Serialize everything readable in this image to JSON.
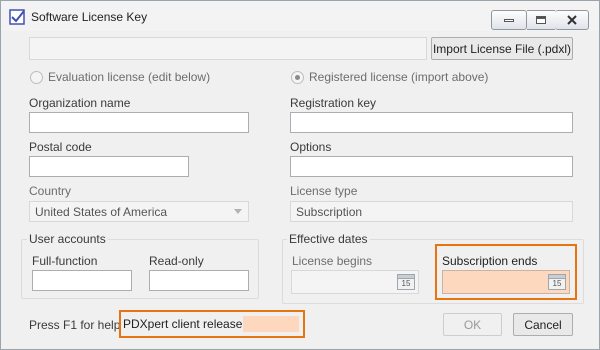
{
  "window": {
    "title": "Software License Key"
  },
  "toolbar": {
    "import_label": "Import License File (.pdxl)"
  },
  "license_mode": {
    "evaluation_label": "Evaluation license (edit below)",
    "registered_label": "Registered license (import above)",
    "selected": "registered"
  },
  "form": {
    "organization_label": "Organization name",
    "organization_value": "",
    "postal_label": "Postal code",
    "postal_value": "",
    "country_label": "Country",
    "country_value": "United States of America",
    "registration_key_label": "Registration key",
    "registration_key_value": "",
    "options_label": "Options",
    "options_value": "",
    "license_type_label": "License type",
    "license_type_value": "Subscription"
  },
  "user_accounts": {
    "title": "User accounts",
    "full_function_label": "Full-function",
    "full_function_value": "",
    "read_only_label": "Read-only",
    "read_only_value": ""
  },
  "effective_dates": {
    "title": "Effective dates",
    "license_begins_label": "License begins",
    "license_begins_value": "",
    "subscription_ends_label": "Subscription ends",
    "subscription_ends_value": "",
    "calendar_day": "15"
  },
  "footer": {
    "help_text": "Press F1 for help.",
    "release_label": "PDXpert client release",
    "release_value": "",
    "ok_label": "OK",
    "cancel_label": "Cancel"
  },
  "colors": {
    "highlight": "#e8740f",
    "highlight_fill": "#fdd8bf"
  },
  "icons": [
    "app-checkbox-icon",
    "minimize-icon",
    "maximize-icon",
    "close-icon",
    "calendar-icon",
    "dropdown-chevron-icon"
  ]
}
